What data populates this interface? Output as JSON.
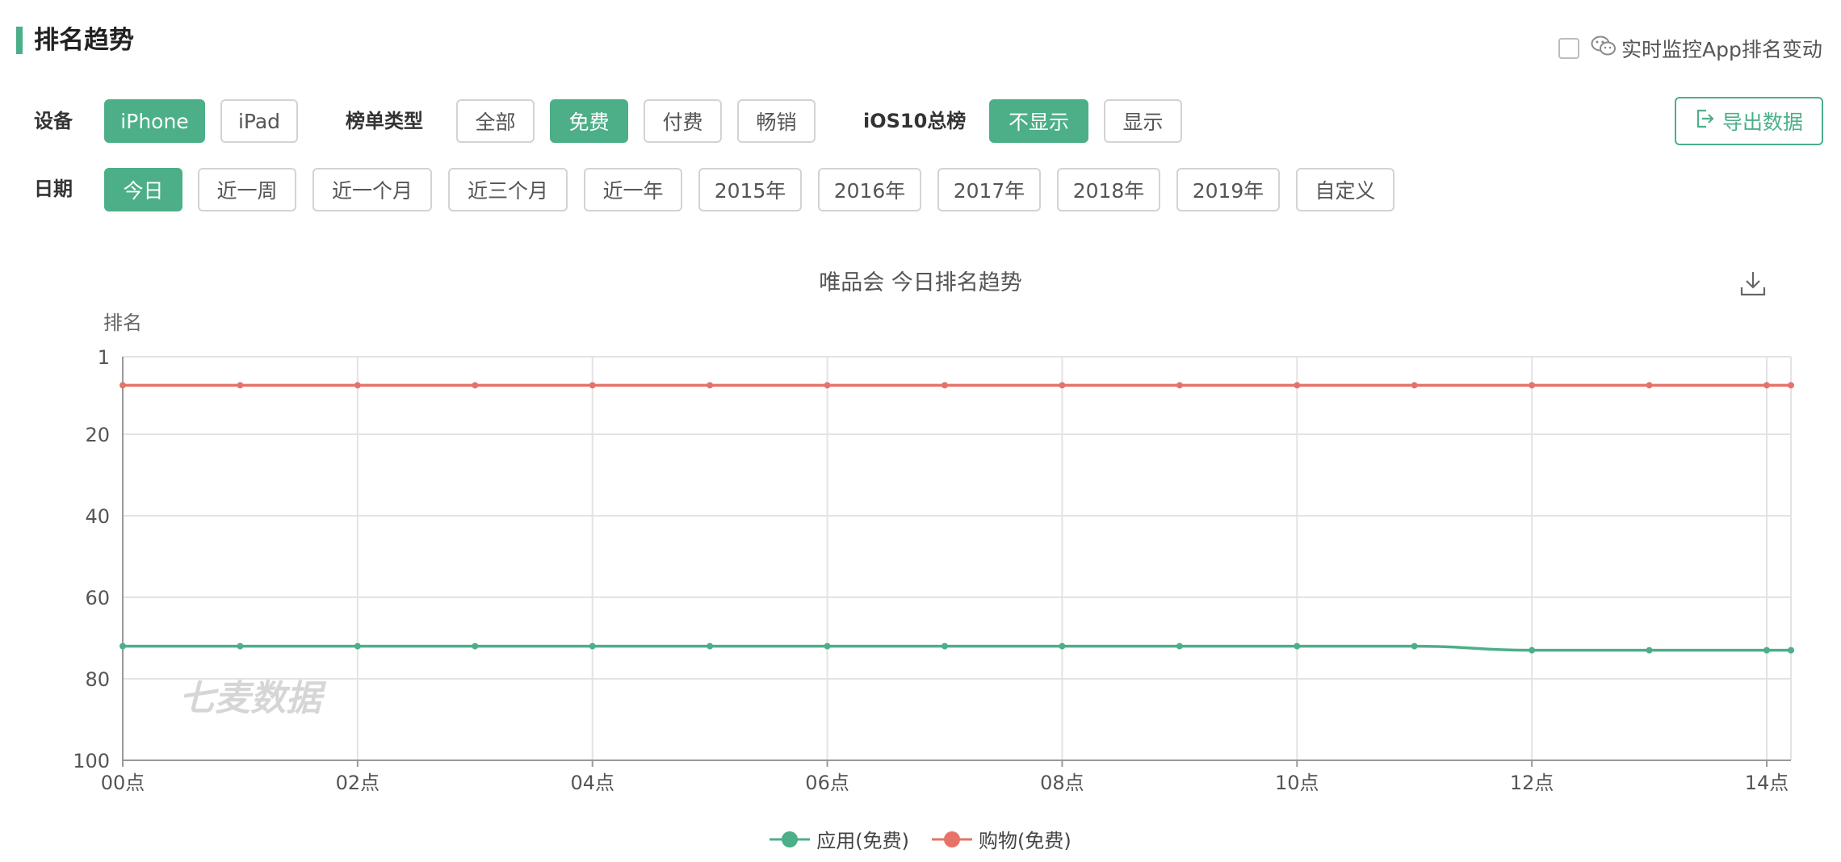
{
  "header": {
    "title": "排名趋势"
  },
  "monitor": {
    "label": "实时监控App排名变动"
  },
  "export": {
    "label": "导出数据"
  },
  "filters": {
    "device": {
      "label": "设备",
      "options": [
        "iPhone",
        "iPad"
      ],
      "selected": "iPhone"
    },
    "list_type": {
      "label": "榜单类型",
      "options": [
        "全部",
        "免费",
        "付费",
        "畅销"
      ],
      "selected": "免费"
    },
    "ios10": {
      "label": "iOS10总榜",
      "options": [
        "不显示",
        "显示"
      ],
      "selected": "不显示"
    },
    "date": {
      "label": "日期",
      "options": [
        "今日",
        "近一周",
        "近一个月",
        "近三个月",
        "近一年",
        "2015年",
        "2016年",
        "2017年",
        "2018年",
        "2019年",
        "自定义"
      ],
      "selected": "今日"
    }
  },
  "watermark": "七麦数据",
  "colors": {
    "accent": "#4caf88",
    "series_app": "#4caf88",
    "series_shopping": "#e57368"
  },
  "chart_data": {
    "type": "line",
    "title": "唯品会 今日排名趋势",
    "ylabel": "排名",
    "xlabel": "",
    "y_inverted": true,
    "ylim": [
      1,
      100
    ],
    "y_ticks": [
      1,
      20,
      40,
      60,
      80,
      100
    ],
    "x_tick_labels": [
      "00点",
      "02点",
      "04点",
      "06点",
      "08点",
      "10点",
      "12点",
      "14点"
    ],
    "x_hours": [
      0,
      1,
      2,
      3,
      4,
      5,
      6,
      7,
      8,
      9,
      10,
      11,
      12,
      13,
      14,
      14.2
    ],
    "series": [
      {
        "name": "应用(免费)",
        "color": "#4caf88",
        "values": [
          72,
          72,
          72,
          72,
          72,
          72,
          72,
          72,
          72,
          72,
          72,
          72,
          73,
          73,
          73,
          73
        ]
      },
      {
        "name": "购物(免费)",
        "color": "#e57368",
        "values": [
          8,
          8,
          8,
          8,
          8,
          8,
          8,
          8,
          8,
          8,
          8,
          8,
          8,
          8,
          8,
          8
        ]
      }
    ],
    "legend_position": "bottom-center",
    "grid": true
  }
}
